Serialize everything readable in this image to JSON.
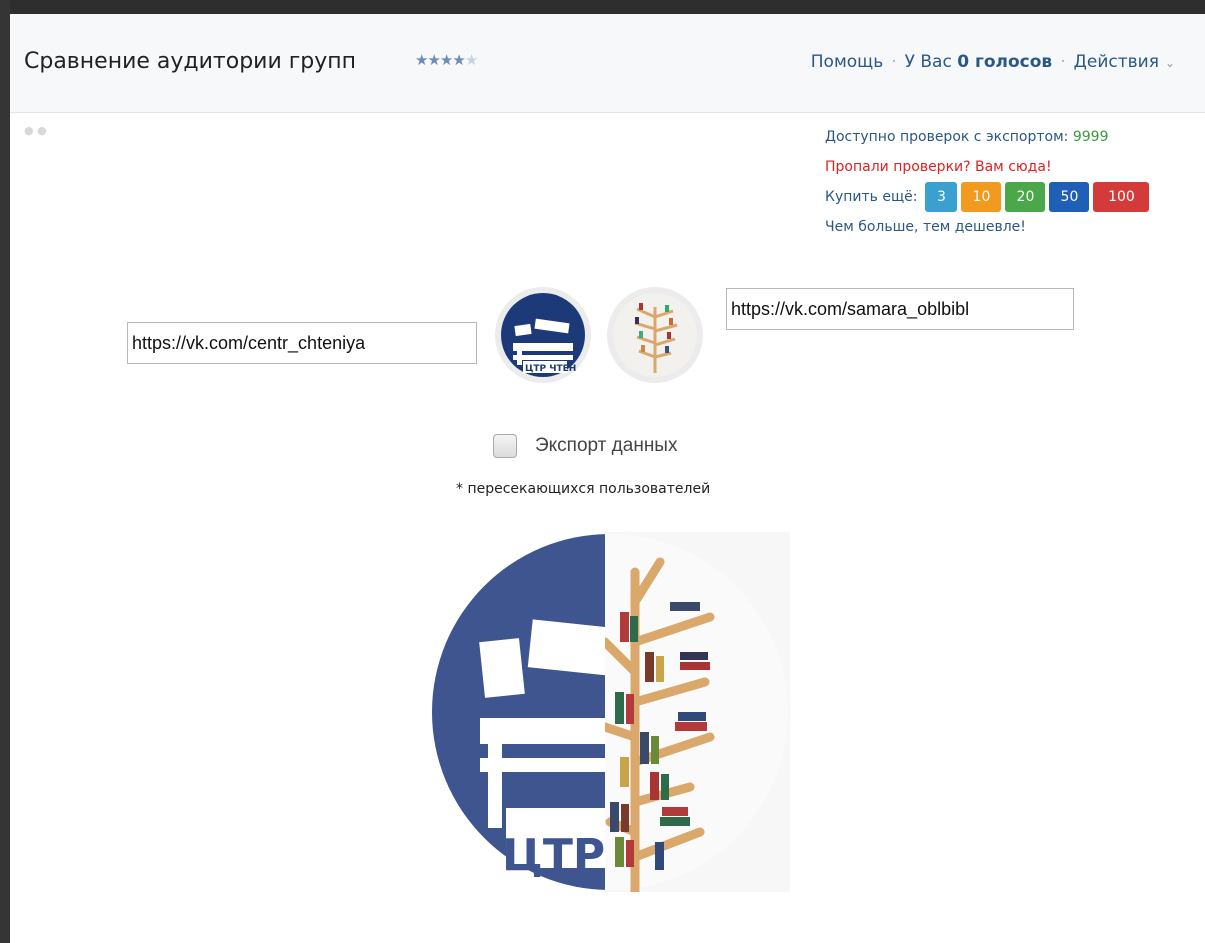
{
  "header": {
    "title": "Сравнение аудитории групп",
    "rating_stars": 4,
    "rating_max": 5,
    "help_link": "Помощь",
    "votes_prefix": "У Вас",
    "votes_value": "0 голосов",
    "actions_label": "Действия"
  },
  "info": {
    "checks_label": "Доступно проверок с экспортом:",
    "checks_value": "9999",
    "lost_checks_link": "Пропали проверки? Вам сюда!",
    "buy_more_label": "Купить ещё:",
    "buy_options": [
      "3",
      "10",
      "20",
      "50",
      "100"
    ],
    "cheaper_note": "Чем больше, тем дешевле!"
  },
  "form": {
    "group1_url": "https://vk.com/centr_chteniya",
    "group2_url": "https://vk.com/samara_oblbibl",
    "export_label": "Экспорт данных",
    "note": "* пересекающихся пользователей"
  },
  "colors": {
    "brand_blue": "#2a5885",
    "logo_blue": "#3f5590",
    "green": "#3a9a3a",
    "red": "#dd2222",
    "shelf_wood": "#d9a86a"
  },
  "icons": {
    "group1_avatar": "centr-chteniya-logo",
    "group2_avatar": "book-tree-image",
    "dropdown": "chevron-down-icon"
  }
}
